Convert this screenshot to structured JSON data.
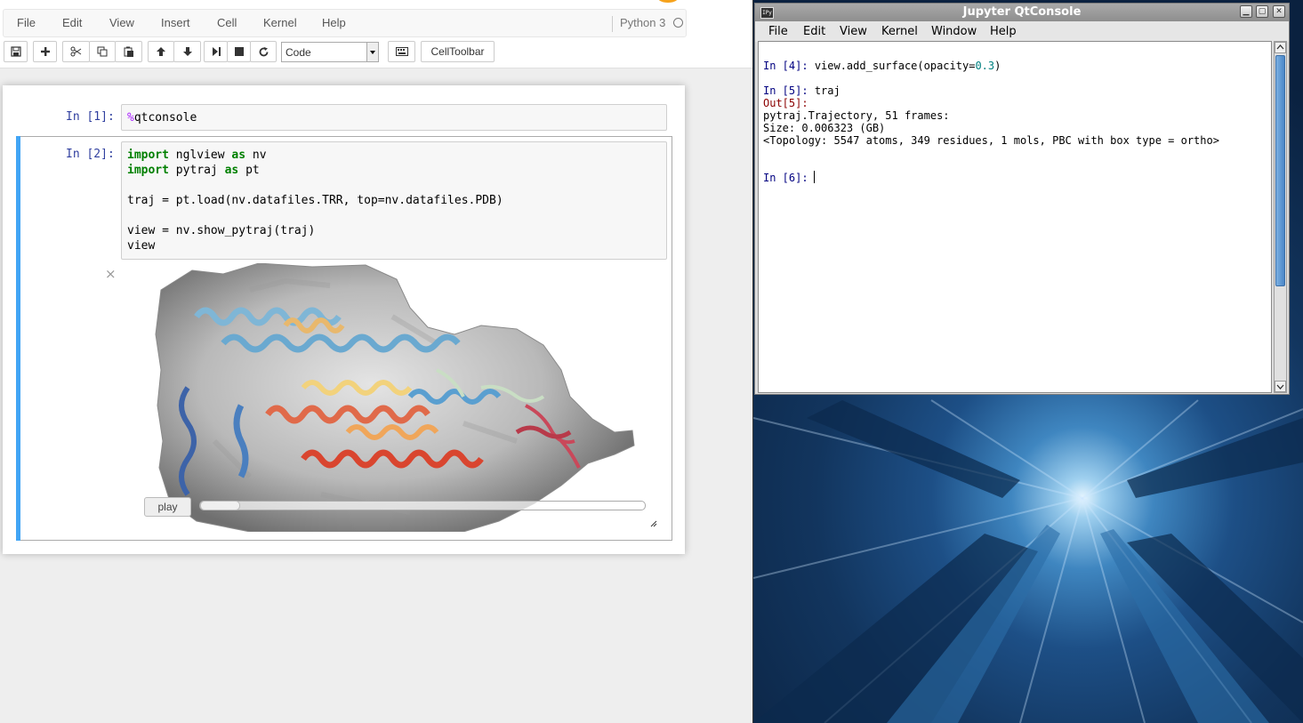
{
  "notebook": {
    "menu": [
      "File",
      "Edit",
      "View",
      "Insert",
      "Cell",
      "Kernel",
      "Help"
    ],
    "kernel_name": "Python 3",
    "toolbar": {
      "cell_type": "Code",
      "celltoolbar_label": "CellToolbar"
    },
    "cells": [
      {
        "prompt": "In [1]:",
        "code_lines": [
          "%qtconsole"
        ]
      },
      {
        "prompt": "In [2]:",
        "code_lines": [
          "import nglview as nv",
          "import pytraj as pt",
          "",
          "traj = pt.load(nv.datafiles.TRR, top=nv.datafiles.PDB)",
          "",
          "view = nv.show_pytraj(traj)",
          "view"
        ]
      }
    ],
    "widget": {
      "close_symbol": "×",
      "play_label": "play",
      "frame_progress": 0.0
    }
  },
  "qtconsole": {
    "title": "Jupyter QtConsole",
    "app_icon": "IPy",
    "menu": [
      "File",
      "Edit",
      "View",
      "Kernel",
      "Window",
      "Help"
    ],
    "lines": {
      "in4_prompt": "In [4]:",
      "in4_code_a": "view.add_surface(opacity=",
      "in4_code_num": "0.3",
      "in4_code_b": ")",
      "in5_prompt": "In [5]:",
      "in5_code": "traj",
      "out5_prompt": "Out[5]:",
      "out_line1": "pytraj.Trajectory, 51 frames:",
      "out_line2": "Size: 0.006323 (GB)",
      "out_line3": "<Topology: 5547 atoms, 349 residues, 1 mols, PBC with box type = ortho>",
      "in6_prompt": "In [6]:"
    }
  },
  "colors": {
    "selected_cell_bar": "#42a5f5",
    "prompt_blue": "#303f9f",
    "keyword_green": "#008000",
    "magic_purple": "#aa22ff",
    "desktop_blue": "#1d4f86"
  }
}
